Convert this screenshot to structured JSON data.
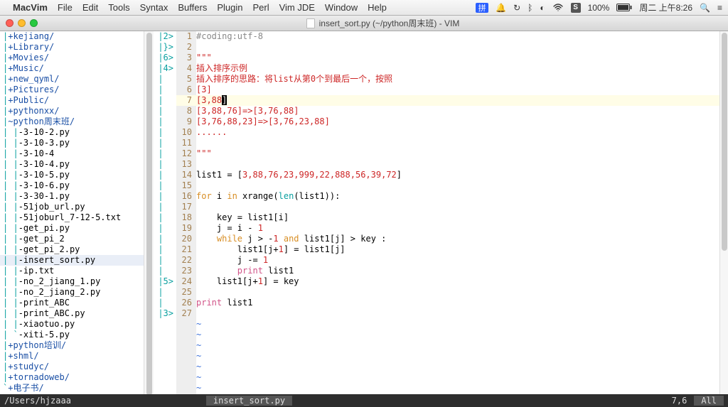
{
  "menubar": {
    "apple": "",
    "items": [
      "MacVim",
      "File",
      "Edit",
      "Tools",
      "Syntax",
      "Buffers",
      "Plugin",
      "Perl",
      "Vim JDE",
      "Window",
      "Help"
    ],
    "right": {
      "battery": "100%",
      "clock": "周二 上午8:26"
    }
  },
  "titlebar": {
    "text": "insert_sort.py (~/python周末班) - VIM"
  },
  "nerdtree": {
    "rows": [
      {
        "pipe": "|",
        "plus": "+",
        "name": "kejiang/",
        "dir": true
      },
      {
        "pipe": "|",
        "plus": "+",
        "name": "Library/",
        "dir": true
      },
      {
        "pipe": "|",
        "plus": "+",
        "name": "Movies/",
        "dir": true
      },
      {
        "pipe": "|",
        "plus": "+",
        "name": "Music/",
        "dir": true
      },
      {
        "pipe": "|",
        "plus": "+",
        "name": "new_qyml/",
        "dir": true
      },
      {
        "pipe": "|",
        "plus": "+",
        "name": "Pictures/",
        "dir": true
      },
      {
        "pipe": "|",
        "plus": "+",
        "name": "Public/",
        "dir": true
      },
      {
        "pipe": "|",
        "plus": "+",
        "name": "pythonxx/",
        "dir": true
      },
      {
        "pipe": "|",
        "plus": "~",
        "name": "python周末班/",
        "dir": true
      },
      {
        "pipe": "| |",
        "dash": "-",
        "name": "3-10-2.py",
        "dir": false
      },
      {
        "pipe": "| |",
        "dash": "-",
        "name": "3-10-3.py",
        "dir": false
      },
      {
        "pipe": "| |",
        "dash": "-",
        "name": "3-10-4",
        "dir": false
      },
      {
        "pipe": "| |",
        "dash": "-",
        "name": "3-10-4.py",
        "dir": false
      },
      {
        "pipe": "| |",
        "dash": "-",
        "name": "3-10-5.py",
        "dir": false
      },
      {
        "pipe": "| |",
        "dash": "-",
        "name": "3-10-6.py",
        "dir": false
      },
      {
        "pipe": "| |",
        "dash": "-",
        "name": "3-30-1.py",
        "dir": false
      },
      {
        "pipe": "| |",
        "dash": "-",
        "name": "51job_url.py",
        "dir": false
      },
      {
        "pipe": "| |",
        "dash": "-",
        "name": "51joburl_7-12-5.txt",
        "dir": false
      },
      {
        "pipe": "| |",
        "dash": "-",
        "name": "get_pi.py",
        "dir": false
      },
      {
        "pipe": "| |",
        "dash": "-",
        "name": "get_pi_2",
        "dir": false
      },
      {
        "pipe": "| |",
        "dash": "-",
        "name": "get_pi_2.py",
        "dir": false
      },
      {
        "pipe": "| |",
        "dash": "-",
        "name": "insert_sort.py",
        "dir": false,
        "sel": true
      },
      {
        "pipe": "| |",
        "dash": "-",
        "name": "ip.txt",
        "dir": false
      },
      {
        "pipe": "| |",
        "dash": "-",
        "name": "no_2_jiang_1.py",
        "dir": false
      },
      {
        "pipe": "| |",
        "dash": "-",
        "name": "no_2_jiang_2.py",
        "dir": false
      },
      {
        "pipe": "| |",
        "dash": "-",
        "name": "print_ABC",
        "dir": false
      },
      {
        "pipe": "| |",
        "dash": "-",
        "name": "print_ABC.py",
        "dir": false
      },
      {
        "pipe": "| |",
        "dash": "-",
        "name": "xiaotuo.py",
        "dir": false
      },
      {
        "pipe": "| `",
        "dash": "-",
        "name": "xiti-5.py",
        "dir": false
      },
      {
        "pipe": "|",
        "plus": "+",
        "name": "python培训/",
        "dir": true
      },
      {
        "pipe": "|",
        "plus": "+",
        "name": "shml/",
        "dir": true
      },
      {
        "pipe": "|",
        "plus": "+",
        "name": "studyc/",
        "dir": true
      },
      {
        "pipe": "|",
        "plus": "+",
        "name": "tornadoweb/",
        "dir": true
      },
      {
        "pipe": "`",
        "plus": "+",
        "name": "电子书/",
        "dir": true
      }
    ]
  },
  "signs": [
    "|2>",
    "|}>",
    "|6>",
    "|4>",
    "|",
    "|",
    "|",
    "|",
    "|",
    "|",
    "|",
    "|",
    "|",
    "|",
    "|",
    "|",
    "|",
    "|",
    "|",
    "|",
    "|",
    "|",
    "|",
    "|5>",
    "|",
    "|",
    "|3>"
  ],
  "code_lines": 27,
  "code": {
    "l1": "#coding:utf-8",
    "l3": "\"\"\"",
    "l4": "插入排序示例",
    "l5": "插入排序的思路：将list从第0个到最后一个，按照",
    "l6": "[3]",
    "l7a": "[3,88",
    "l7b": "]",
    "l8": "[3,88,76]=>[3,76,88]",
    "l9": "[3,76,88,23]=>[3,76,23,88]",
    "l10": "......",
    "l12": "\"\"\"",
    "l14_pre": "list1 = [",
    "l14_nums": "3,88,76,23,999,22,888,56,39,72",
    "l14_post": "]",
    "l16_for": "for",
    "l16_mid": " i ",
    "l16_in": "in",
    "l16_xr": " xrange(",
    "l16_len": "len",
    "l16_end": "(list1)):",
    "l18": "    key = list1[i]",
    "l19a": "    j = i - ",
    "l19b": "1",
    "l20a": "    ",
    "l20_while": "while",
    "l20b": " j > -",
    "l20c": "1",
    "l20d": " ",
    "l20_and": "and",
    "l20e": " list1[j] > key :",
    "l21a": "        list1[j+",
    "l21b": "1",
    "l21c": "] = list1[j]",
    "l22a": "        j -= ",
    "l22b": "1",
    "l23a": "        ",
    "l23_print": "print",
    "l23b": " list1",
    "l24a": "    list1[j+",
    "l24b": "1",
    "l24c": "] = key",
    "l26_print": "print",
    "l26b": " list1"
  },
  "status": {
    "path": "/Users/hjzaaa",
    "file": "insert_sort.py",
    "pos": "7,6",
    "pct": "All"
  }
}
